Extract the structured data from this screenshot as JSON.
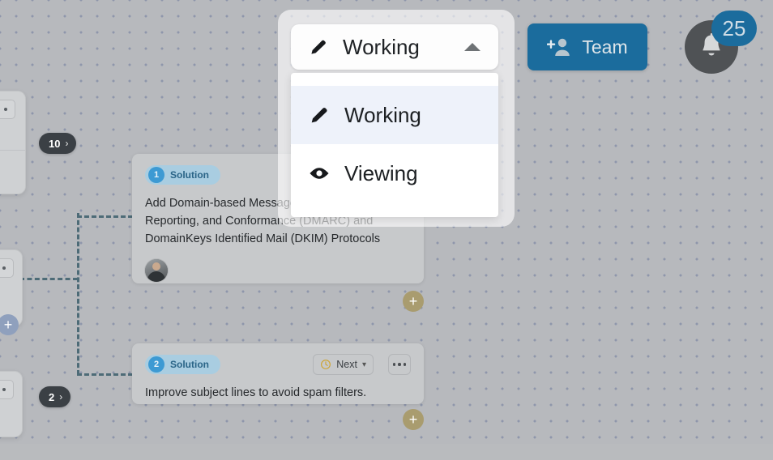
{
  "mode_selector": {
    "current_label": "Working",
    "current_icon": "pencil-icon",
    "caret_icon": "caret-up-icon",
    "options": [
      {
        "label": "Working",
        "icon": "pencil-icon",
        "selected": true
      },
      {
        "label": "Viewing",
        "icon": "eye-icon",
        "selected": false
      }
    ]
  },
  "toolbar": {
    "team_label": "Team",
    "team_icon": "person-add-icon",
    "team_color": "#1b6c9d",
    "notification_icon": "bell-icon",
    "notification_count": "25",
    "notification_badge_color": "#1b6c9d"
  },
  "cards": [
    {
      "badge_number": "1",
      "badge_label": "Solution",
      "text": "Add Domain-based Message Authentication, Reporting, and Conformance (DMARC) and DomainKeys Identified Mail (DKIM) Protocols",
      "has_avatar": true,
      "add_button_icon": "plus-icon"
    },
    {
      "badge_number": "2",
      "badge_label": "Solution",
      "text": "Improve subject lines to avoid spam filters.",
      "status_label": "Next",
      "status_icon": "clock-icon",
      "status_caret": "chevron-down-icon",
      "more_icon": "ellipsis-icon",
      "has_avatar": false,
      "add_button_icon": "plus-icon"
    }
  ],
  "count_pills": [
    {
      "count": "10",
      "chevron": "›"
    },
    {
      "count": "2",
      "chevron": "›"
    }
  ],
  "side_add_button": {
    "icon": "plus-icon"
  },
  "colors": {
    "canvas_background": "#b7b9bd",
    "dot_grid": "#8e96ab",
    "card_background": "#c7c9cb",
    "solution_pill": "#a9cde1",
    "solution_number": "#3d9ad3",
    "connector_line": "#4d6b77",
    "pill_dark": "#3b4045",
    "menu_highlight": "#eef2fa"
  }
}
